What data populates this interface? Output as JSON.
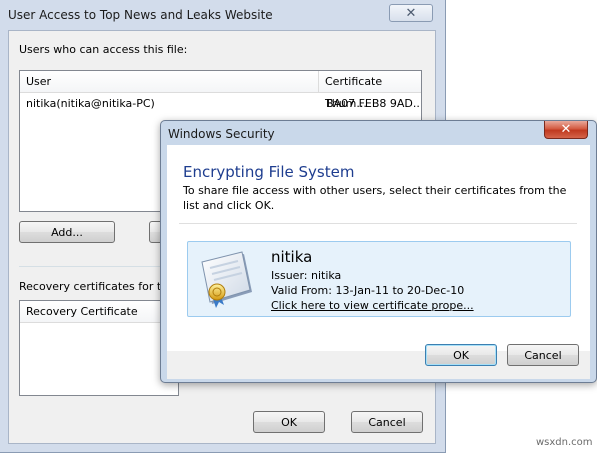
{
  "back_dialog": {
    "title": "User Access to Top News and Leaks Website",
    "users_label": "Users who can access this file:",
    "columns": [
      "User",
      "Certificate Thum..."
    ],
    "rows": [
      {
        "user": "nitika(nitika@nitika-PC)",
        "thumb": "BA07 FEB8 9AD..."
      }
    ],
    "add_label": "Add...",
    "recovery_label": "Recovery certificates for this fi",
    "recovery_column": "Recovery Certificate",
    "ok_label": "OK",
    "cancel_label": "Cancel",
    "close_glyph": "✕"
  },
  "front_dialog": {
    "title": "Windows Security",
    "heading": "Encrypting File System",
    "description": "To share file access with other users, select their certificates from the list and click OK.",
    "cert": {
      "name": "nitika",
      "issuer": "Issuer: nitika",
      "valid": "Valid From: 13-Jan-11 to 20-Dec-10",
      "link": "Click here to view certificate prope..."
    },
    "ok_label": "OK",
    "cancel_label": "Cancel",
    "close_glyph": "✕"
  },
  "watermark": "wsxdn.com",
  "colors": {
    "heading_blue": "#1e3d8f",
    "cert_box_bg": "#e6f2fb",
    "close_red": "#c0391f"
  }
}
